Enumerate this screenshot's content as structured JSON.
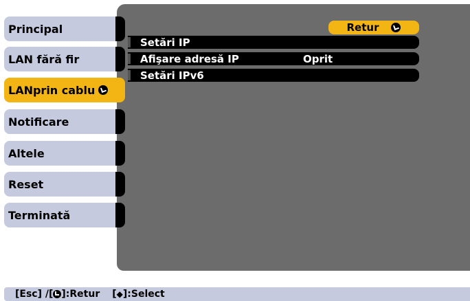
{
  "sidebar": {
    "items": [
      {
        "label": "Principal",
        "active": false
      },
      {
        "label": "LAN fără fir",
        "active": false
      },
      {
        "label": "LANprin cablu",
        "active": true
      },
      {
        "label": "Notificare",
        "active": false
      },
      {
        "label": "Altele",
        "active": false
      },
      {
        "label": "Reset",
        "active": false
      },
      {
        "label": "Terminată",
        "active": false
      }
    ]
  },
  "panel": {
    "retur_label": "Retur",
    "rows": [
      {
        "label": "Setări IP",
        "value": ""
      },
      {
        "label": "Afişare adresă IP",
        "value": "Oprit"
      },
      {
        "label": "Setări IPv6",
        "value": ""
      }
    ]
  },
  "footer": {
    "esc": "[Esc] /[",
    "retur": "]:Retur",
    "select_open": "[",
    "updown": "◆",
    "select": "]:Select"
  },
  "colors": {
    "accent": "#f2b514",
    "tab": "#c6cadf",
    "panel": "#6c6c6c"
  }
}
